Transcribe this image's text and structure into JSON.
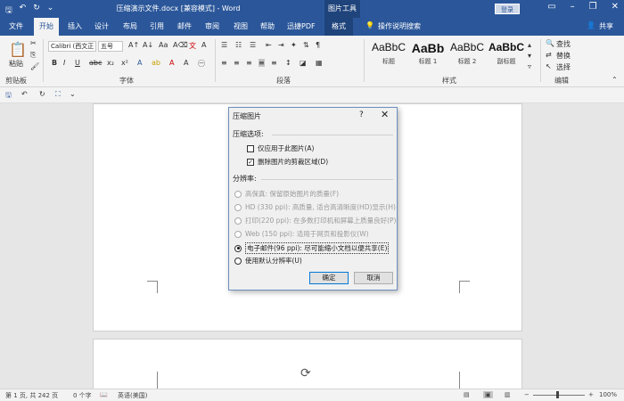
{
  "window": {
    "title": "压缩演示文件.docx [兼容模式] - Word",
    "picture_tools_label": "图片工具",
    "login_label": "登录",
    "min_glyph": "–",
    "restore_glyph": "❐",
    "close_glyph": "✕"
  },
  "tabs": [
    "文件",
    "开始",
    "插入",
    "设计",
    "布局",
    "引用",
    "邮件",
    "审阅",
    "视图",
    "帮助",
    "迅捷PDF",
    "格式"
  ],
  "active_tab": "开始",
  "search_label": "操作说明搜索",
  "share_label": "共享",
  "ribbon": {
    "clipboard": {
      "paste_label": "粘贴",
      "group_label": "剪贴板"
    },
    "font": {
      "font_name": "Calibri (西文正",
      "font_size": "五号",
      "group_label": "字体"
    },
    "paragraph": {
      "group_label": "段落"
    },
    "styles": {
      "group_label": "样式",
      "items": [
        {
          "sample": "AaBbC",
          "name": "标题"
        },
        {
          "sample": "AaBb",
          "name": "标题 1"
        },
        {
          "sample": "AaBbC",
          "name": "标题 2"
        },
        {
          "sample": "AaBbC",
          "name": "副标题"
        }
      ]
    },
    "editing": {
      "find": "查找",
      "replace": "替换",
      "select": "选择",
      "group_label": "编辑"
    }
  },
  "dialog": {
    "title": "压缩图片",
    "help": "?",
    "close": "✕",
    "compress_section": "压缩选项:",
    "compress_options": [
      {
        "label": "仅应用于此图片(A)",
        "checked": false
      },
      {
        "label": "删除图片的剪裁区域(D)",
        "checked": true
      }
    ],
    "resolution_section": "分辨率:",
    "resolution_options": [
      {
        "label": "高保真: 保留原始图片的质量(F)",
        "enabled": false,
        "selected": false
      },
      {
        "label": "HD (330 ppi): 高质量, 适合高清晰度(HD)显示(H)",
        "enabled": false,
        "selected": false
      },
      {
        "label": "打印(220 ppi): 在多数打印机和屏幕上质量良好(P)",
        "enabled": false,
        "selected": false
      },
      {
        "label": "Web (150 ppi): 适用于网页和投影仪(W)",
        "enabled": false,
        "selected": false
      },
      {
        "label": "电子邮件(96 ppi): 尽可能缩小文档以便共享(E)",
        "enabled": true,
        "selected": true
      },
      {
        "label": "使用默认分辨率(U)",
        "enabled": true,
        "selected": false
      }
    ],
    "ok_label": "确定",
    "cancel_label": "取消"
  },
  "status": {
    "page": "第 1 页, 共 242 页",
    "words": "0 个字",
    "language": "英语(美国)",
    "zoom": "100%",
    "zoom_minus": "−",
    "zoom_plus": "+"
  }
}
